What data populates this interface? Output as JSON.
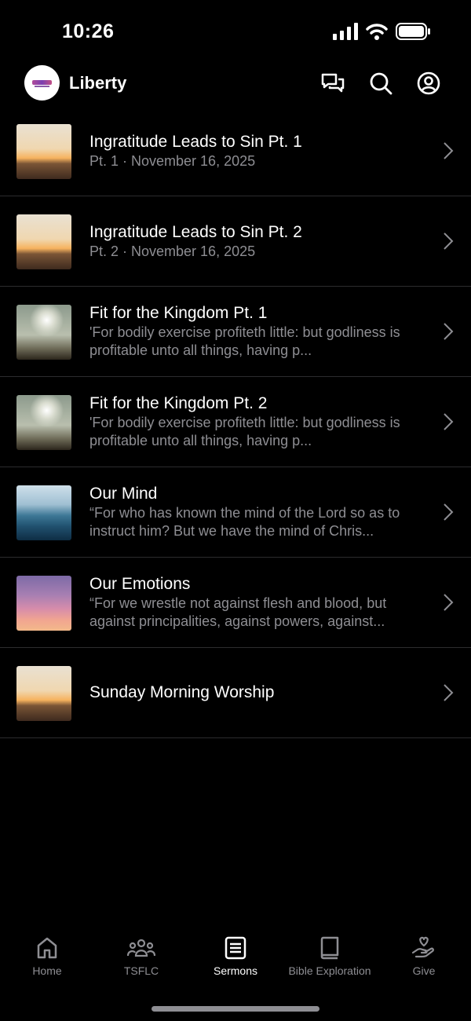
{
  "status_bar": {
    "time": "10:26"
  },
  "header": {
    "app_name": "Liberty"
  },
  "sermons": [
    {
      "title": "Ingratitude Leads to Sin Pt. 1",
      "subtitle": "Pt. 1 · November 16, 2025",
      "thumb": "sunset-horizon"
    },
    {
      "title": "Ingratitude Leads to Sin Pt. 2",
      "subtitle": "Pt. 2 · November 16, 2025",
      "thumb": "sunset-horizon"
    },
    {
      "title": "Fit for the Kingdom Pt. 1",
      "subtitle": "'For bodily exercise profiteth little: but godliness is profitable unto all things, having p...",
      "thumb": "cloudy-sky"
    },
    {
      "title": "Fit for the Kingdom Pt. 2",
      "subtitle": "'For bodily exercise profiteth little: but godliness is profitable unto all things, having p...",
      "thumb": "cloudy-sky"
    },
    {
      "title": "Our Mind",
      "subtitle": "“For who has known the mind of the Lord so as to instruct him? But we have the mind of Chris...",
      "thumb": "ocean-waves"
    },
    {
      "title": "Our Emotions",
      "subtitle": "“For we wrestle not against flesh and blood, but against principalities, against powers, against...",
      "thumb": "pink-sky"
    },
    {
      "title": "Sunday Morning Worship",
      "subtitle": "",
      "thumb": "sunset-horizon"
    }
  ],
  "tabs": [
    {
      "label": "Home",
      "icon": "home-icon",
      "active": false
    },
    {
      "label": "TSFLC",
      "icon": "group-icon",
      "active": false
    },
    {
      "label": "Sermons",
      "icon": "sermons-icon",
      "active": true
    },
    {
      "label": "Bible Exploration",
      "icon": "book-icon",
      "active": false
    },
    {
      "label": "Give",
      "icon": "give-icon",
      "active": false
    }
  ]
}
